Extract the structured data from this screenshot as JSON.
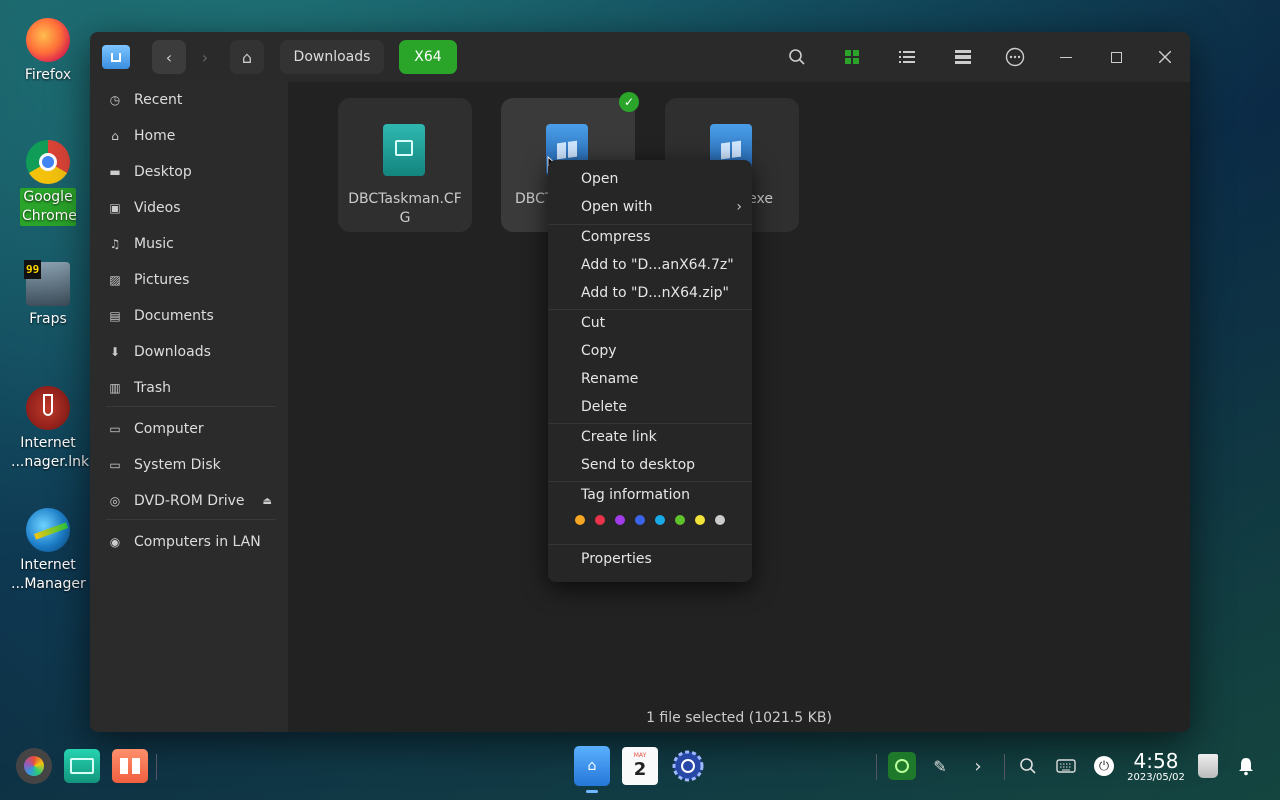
{
  "desktop": {
    "icons": [
      {
        "label": "Firefox",
        "icon": "firefox-icon"
      },
      {
        "label": "Google Chrome",
        "icon": "chrome-icon"
      },
      {
        "label": "Fraps",
        "icon": "fraps-icon"
      },
      {
        "label": "Internet ...nager.lnk",
        "icon": "wine-icon"
      },
      {
        "label": "Internet ...Manager",
        "icon": "idm-icon"
      }
    ]
  },
  "window": {
    "breadcrumb": {
      "folder": "Downloads",
      "current": "X64"
    },
    "sidebar": {
      "items": [
        {
          "label": "Recent",
          "icon": "clock-icon"
        },
        {
          "label": "Home",
          "icon": "home-icon"
        },
        {
          "label": "Desktop",
          "icon": "desktop-icon"
        },
        {
          "label": "Videos",
          "icon": "video-icon"
        },
        {
          "label": "Music",
          "icon": "music-icon"
        },
        {
          "label": "Pictures",
          "icon": "picture-icon"
        },
        {
          "label": "Documents",
          "icon": "document-icon"
        },
        {
          "label": "Downloads",
          "icon": "download-icon"
        },
        {
          "label": "Trash",
          "icon": "trash-icon"
        },
        {
          "label": "Computer",
          "icon": "computer-icon"
        },
        {
          "label": "System Disk",
          "icon": "disk-icon"
        },
        {
          "label": "DVD-ROM Drive",
          "icon": "dvd-icon"
        },
        {
          "label": "Computers in LAN",
          "icon": "network-icon"
        }
      ]
    },
    "files": [
      {
        "name": "DBCTaskman.CFG",
        "name_line1": "DBCTaskman.CF",
        "name_line2": "G"
      },
      {
        "name_visible": "DBCT"
      },
      {
        "name_visible": "exe"
      }
    ],
    "status": "1 file selected (1021.5 KB)"
  },
  "context_menu": {
    "open": "Open",
    "open_with": "Open with",
    "compress": "Compress",
    "add_7z": "Add to \"D...anX64.7z\"",
    "add_zip": "Add to \"D...nX64.zip\"",
    "cut": "Cut",
    "copy": "Copy",
    "rename": "Rename",
    "delete": "Delete",
    "create_link": "Create link",
    "send_to_desktop": "Send to desktop",
    "tag_information": "Tag information",
    "tag_colors": [
      "#f5a623",
      "#e8334a",
      "#a23be8",
      "#3a63e8",
      "#19a9e6",
      "#5fc42a",
      "#f2e33a",
      "#cccccc"
    ],
    "properties": "Properties"
  },
  "dock": {
    "calendar_day": "2",
    "calendar_month": "MAY",
    "clock_time": "4:58",
    "clock_date": "2023/05/02"
  },
  "colors": {
    "accent": "#2aa52a",
    "window_bg": "#252525"
  }
}
